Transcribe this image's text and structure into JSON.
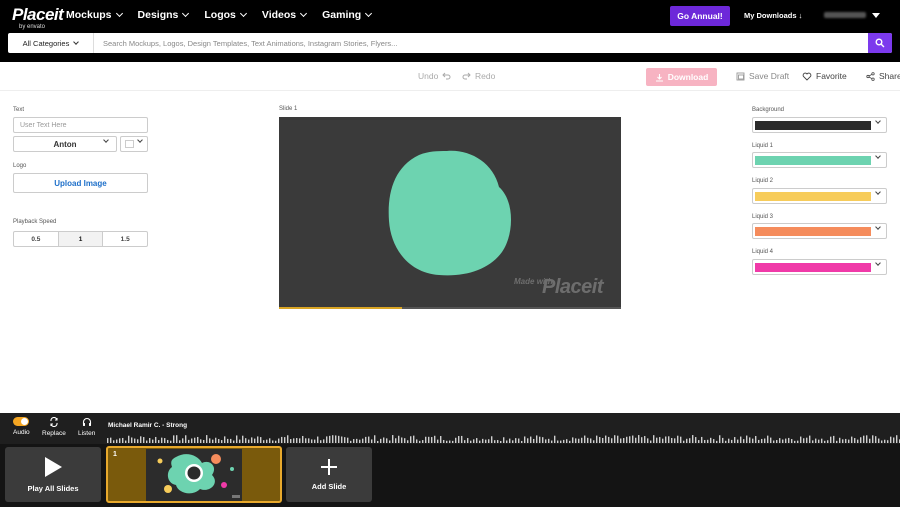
{
  "brand": {
    "logo_text": "Placeit",
    "logo_sub": "by envato"
  },
  "nav": {
    "items": [
      {
        "label": "Mockups"
      },
      {
        "label": "Designs"
      },
      {
        "label": "Logos"
      },
      {
        "label": "Videos"
      },
      {
        "label": "Gaming"
      }
    ],
    "go_annual_label": "Go Annual!",
    "my_downloads_label": "My Downloads"
  },
  "search": {
    "category_label": "All Categories",
    "placeholder": "Search Mockups, Logos, Design Templates, Text Animations, Instagram Stories, Flyers..."
  },
  "toolbar": {
    "undo_label": "Undo",
    "redo_label": "Redo",
    "download_label": "Download",
    "save_draft_label": "Save Draft",
    "favorite_label": "Favorite",
    "share_label": "Share"
  },
  "left_panel": {
    "text_label": "Text",
    "text_placeholder": "User Text Here",
    "font_value": "Anton",
    "logo_label": "Logo",
    "upload_label": "Upload Image",
    "playback_label": "Playback Speed",
    "speeds": [
      {
        "label": "0.5",
        "active": false
      },
      {
        "label": "1",
        "active": true
      },
      {
        "label": "1.5",
        "active": false
      }
    ]
  },
  "canvas": {
    "slide_label": "Slide 1",
    "background_color": "#3a3a3a",
    "blob_color": "#6dd3b0",
    "watermark_made": "Made with",
    "watermark_brand": "Placeit",
    "progress": 0.36
  },
  "right_panel": {
    "colors": [
      {
        "label": "Background",
        "value": "#2b2b2b"
      },
      {
        "label": "Liquid 1",
        "value": "#6dd3b0"
      },
      {
        "label": "Liquid 2",
        "value": "#f7cc5a"
      },
      {
        "label": "Liquid 3",
        "value": "#f58c5c"
      },
      {
        "label": "Liquid 4",
        "value": "#f03aa8"
      }
    ]
  },
  "audio": {
    "audio_label": "Audio",
    "replace_label": "Replace",
    "listen_label": "Listen",
    "track_name": "Michael Ramir C. - Strong"
  },
  "slides": {
    "play_all_label": "Play All Slides",
    "slide_number": "1",
    "add_slide_label": "Add Slide"
  }
}
